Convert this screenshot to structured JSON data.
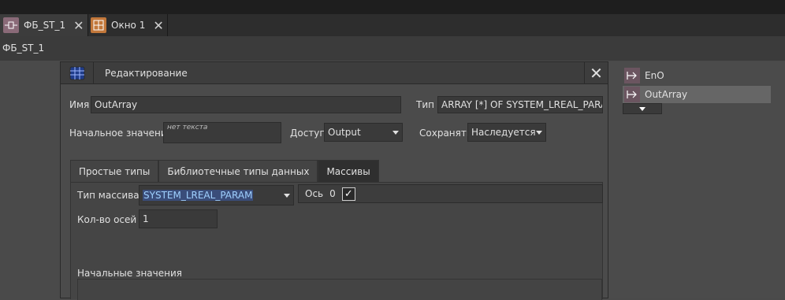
{
  "tabs": [
    {
      "label": "ФБ_ST_1",
      "icon": "function-block-icon",
      "active": true
    },
    {
      "label": "Окно 1",
      "icon": "window-grid-icon",
      "active": false
    }
  ],
  "breadcrumb": "ФБ_ST_1",
  "dialog": {
    "title": "Редактирование",
    "name_label": "Имя",
    "name_value": "OutArray",
    "type_label": "Тип",
    "type_value": "ARRAY [*] OF SYSTEM_LREAL_PARAM",
    "initial_label": "Начальное значение",
    "initial_placeholder": "нет текста",
    "access_label": "Доступ",
    "access_value": "Output",
    "save_label": "Сохранять",
    "save_value": "Наследуется",
    "tabs": [
      "Простые типы",
      "Библиотечные типы данных",
      "Массивы"
    ],
    "array_type_label": "Тип массива:",
    "array_type_value": "SYSTEM_LREAL_PARAM",
    "axis_label": "Ось",
    "axis_value": "0",
    "axis_count_label": "Кол-во осей",
    "axis_count_value": "1",
    "initial_values_label": "Начальные значения"
  },
  "ports": [
    {
      "label": "EnO"
    },
    {
      "label": "OutArray"
    }
  ]
}
